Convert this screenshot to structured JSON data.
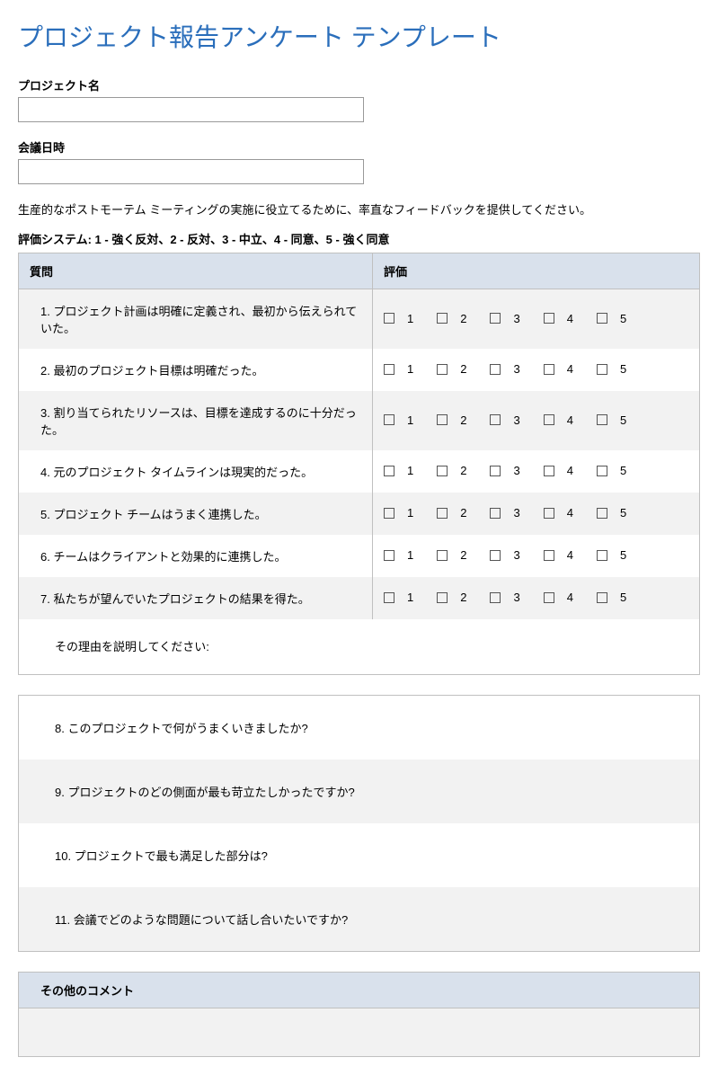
{
  "title": "プロジェクト報告アンケート テンプレート",
  "fields": {
    "projectName": {
      "label": "プロジェクト名",
      "value": ""
    },
    "meetingDate": {
      "label": "会議日時",
      "value": ""
    }
  },
  "intro": "生産的なポストモーテム ミーティングの実施に役立てるために、率直なフィードバックを提供してください。",
  "ratingSystem": "評価システム: 1 - 強く反対、2 - 反対、3 - 中立、4 - 同意、5 - 強く同意",
  "tableHeaders": {
    "question": "質問",
    "rating": "評価"
  },
  "ratingOptions": [
    "1",
    "2",
    "3",
    "4",
    "5"
  ],
  "ratedQuestions": [
    "1. プロジェクト計画は明確に定義され、最初から伝えられていた。",
    "2. 最初のプロジェクト目標は明確だった。",
    "3. 割り当てられたリソースは、目標を達成するのに十分だった。",
    "4. 元のプロジェクト タイムラインは現実的だった。",
    "5. プロジェクト チームはうまく連携した。",
    "6. チームはクライアントと効果的に連携した。",
    "7. 私たちが望んでいたプロジェクトの結果を得た。"
  ],
  "explainLabel": "その理由を説明してください:",
  "openQuestions": [
    "8. このプロジェクトで何がうまくいきましたか?",
    "9. プロジェクトのどの側面が最も苛立たしかったですか?",
    "10. プロジェクトで最も満足した部分は?",
    "11. 会議でどのような問題について話し合いたいですか?"
  ],
  "commentsHeader": "その他のコメント"
}
